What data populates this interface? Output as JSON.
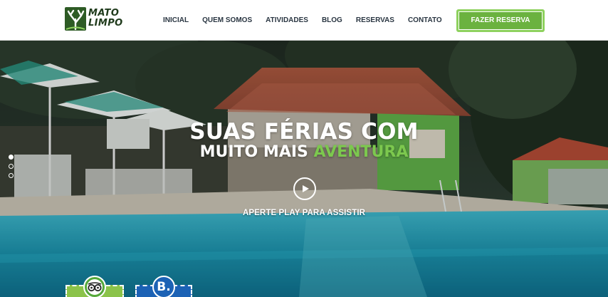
{
  "header": {
    "logo": {
      "line1": "MATO",
      "line2": "LIMPO"
    },
    "nav": [
      "INICIAL",
      "QUEM SOMOS",
      "ATIVIDADES",
      "BLOG",
      "RESERVAS",
      "CONTATO"
    ],
    "cta_label": "FAZER RESERVA"
  },
  "hero": {
    "headline_line1": "SUAS FÉRIAS COM",
    "headline_line2_prefix": "MUITO MAIS ",
    "headline_line2_accent": "AVENTURA",
    "play_caption": "APERTE PLAY PARA ASSISTIR",
    "slide_count": 3,
    "active_slide": 1
  },
  "badges": [
    {
      "icon": "tripadvisor-owl-icon",
      "color": "#55a83a"
    },
    {
      "icon": "booking-b-icon",
      "glyph": "B.",
      "color": "#1c62b5"
    }
  ],
  "colors": {
    "brand_green": "#6bb23f",
    "accent_green": "#7cc84e",
    "nav_text": "#2a3642",
    "white": "#ffffff"
  },
  "icons": {
    "logo": "tree-logo-icon",
    "play": "play-icon"
  }
}
